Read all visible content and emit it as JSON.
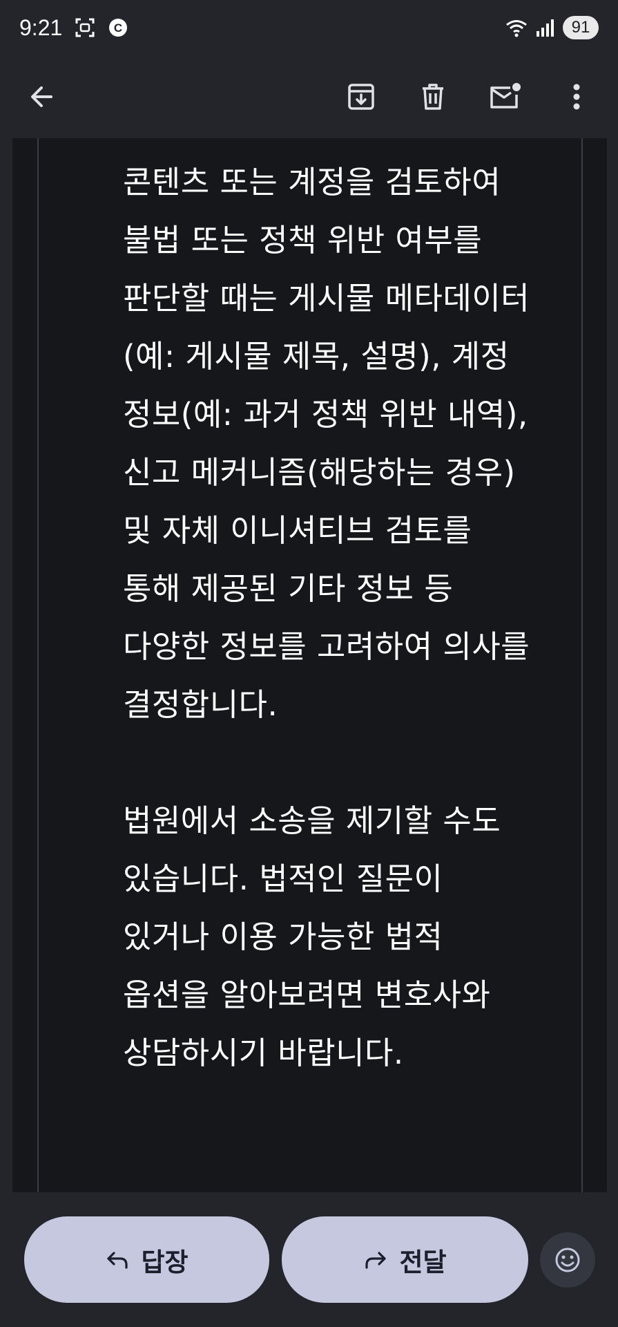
{
  "status_bar": {
    "time": "9:21",
    "battery_level": "91",
    "icons": [
      "screenshot-icon",
      "c-badge-icon",
      "wifi-icon",
      "signal-icon"
    ],
    "c_badge": "C"
  },
  "app_bar": {
    "icons": [
      "back-arrow-icon",
      "archive-icon",
      "delete-icon",
      "mark-unread-icon",
      "more-vert-icon"
    ]
  },
  "message": {
    "paragraphs": [
      "콘텐츠 또는 계정을 검토하여 불법 또는 정책 위반 여부를 판단할 때는 게시물 메타데이터(예: 게시물 제목, 설명), 계정 정보(예: 과거 정책 위반 내역), 신고 메커니즘(해당하는 경우) 및 자체 이니셔티브 검토를 통해 제공된 기타 정보 등 다양한 정보를 고려하여 의사를 결정합니다.",
      "법원에서 소송을 제기할 수도 있습니다. 법적인 질문이 있거나 이용 가능한 법적 옵션을 알아보려면 변호사와 상담하시기 바랍니다."
    ]
  },
  "actions": {
    "reply_label": "답장",
    "forward_label": "전달",
    "icons": [
      "reply-icon",
      "forward-icon",
      "emoji-icon"
    ]
  },
  "colors": {
    "background": "#23252b",
    "content_background": "#16171b",
    "button_fill": "#c5c8de",
    "button_text": "#1c1f2b"
  }
}
